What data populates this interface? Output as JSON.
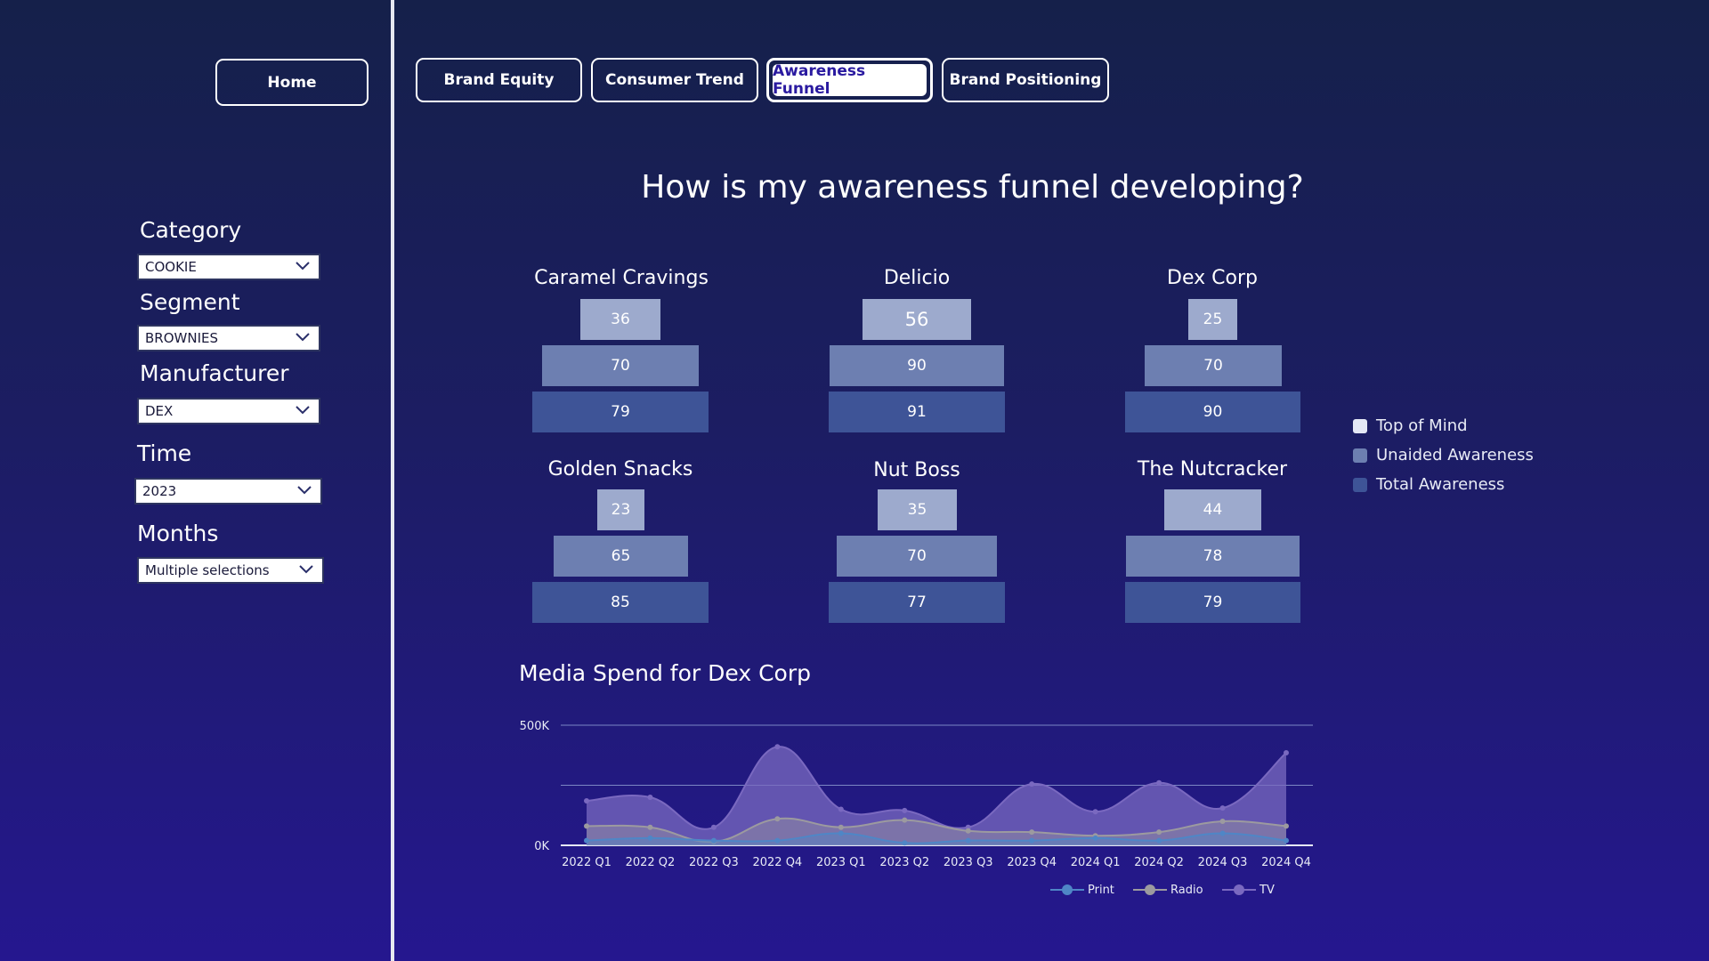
{
  "nav": {
    "home": "Home",
    "tabs": [
      {
        "label": "Brand Equity"
      },
      {
        "label": "Consumer Trend"
      },
      {
        "label": "Awareness Funnel"
      },
      {
        "label": "Brand Positioning"
      }
    ]
  },
  "filters": {
    "category": {
      "label": "Category",
      "value": "COOKIE"
    },
    "segment": {
      "label": "Segment",
      "value": "BROWNIES"
    },
    "manufacturer": {
      "label": "Manufacturer",
      "value": "DEX"
    },
    "time": {
      "label": "Time",
      "value": "2023"
    },
    "months": {
      "label": "Months",
      "value": "Multiple selections"
    }
  },
  "page_title": "How is my awareness funnel developing?",
  "funnels": [
    {
      "brand": "Caramel Cravings",
      "top_of_mind": 36,
      "unaided": 70,
      "total": 79
    },
    {
      "brand": "Delicio",
      "top_of_mind": 56,
      "unaided": 90,
      "total": 91
    },
    {
      "brand": "Dex Corp",
      "top_of_mind": 25,
      "unaided": 70,
      "total": 90
    },
    {
      "brand": "Golden Snacks",
      "top_of_mind": 23,
      "unaided": 65,
      "total": 85
    },
    {
      "brand": "Nut Boss",
      "top_of_mind": 35,
      "unaided": 70,
      "total": 77
    },
    {
      "brand": "The Nutcracker",
      "top_of_mind": 44,
      "unaided": 78,
      "total": 79
    }
  ],
  "funnel_legend": {
    "top_of_mind": "Top of Mind",
    "unaided": "Unaided Awareness",
    "total": "Total Awareness"
  },
  "colors": {
    "top_of_mind": "#9daacd",
    "unaided": "#6d7fb1",
    "total": "#3e5497",
    "print": "#4f86c6",
    "radio": "#9c9a9f",
    "tv": "#7a69c0"
  },
  "chart_data": {
    "type": "area",
    "title": "Media Spend for Dex Corp",
    "categories": [
      "2022 Q1",
      "2022 Q2",
      "2022 Q3",
      "2022 Q4",
      "2023 Q1",
      "2023 Q2",
      "2023 Q3",
      "2023 Q4",
      "2024 Q1",
      "2024 Q2",
      "2024 Q3",
      "2024 Q4"
    ],
    "y_ticks": [
      "0K",
      "500K"
    ],
    "ylim": [
      0,
      500000
    ],
    "grid": true,
    "legend_position": "bottom-right",
    "series": [
      {
        "name": "Print",
        "values": [
          20000,
          30000,
          20000,
          20000,
          50000,
          10000,
          20000,
          20000,
          30000,
          20000,
          50000,
          20000
        ]
      },
      {
        "name": "Radio",
        "values": [
          80000,
          75000,
          15000,
          110000,
          75000,
          105000,
          60000,
          55000,
          40000,
          55000,
          100000,
          80000
        ]
      },
      {
        "name": "TV",
        "values": [
          185000,
          200000,
          75000,
          410000,
          150000,
          145000,
          75000,
          255000,
          140000,
          260000,
          155000,
          385000
        ]
      }
    ]
  }
}
